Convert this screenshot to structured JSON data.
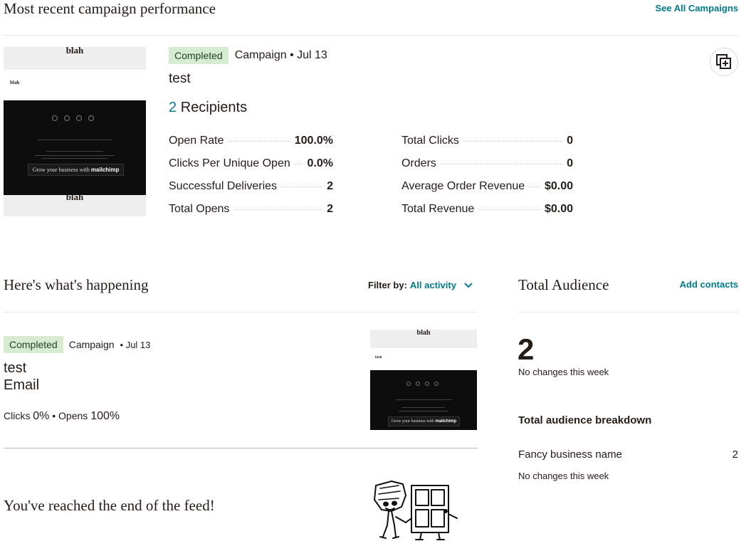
{
  "recent": {
    "heading": "Most recent campaign performance",
    "see_all": "See All Campaigns",
    "badge": "Completed",
    "meta": "Campaign • Jul 13",
    "name": "test",
    "recipients_count": "2",
    "recipients_label": "Recipients",
    "left_stats": [
      {
        "label": "Open Rate",
        "value": "100.0%"
      },
      {
        "label": "Clicks Per Unique Open",
        "value": "0.0%"
      },
      {
        "label": "Successful Deliveries",
        "value": "2"
      },
      {
        "label": "Total Opens",
        "value": "2"
      }
    ],
    "right_stats": [
      {
        "label": "Total Clicks",
        "value": "0"
      },
      {
        "label": "Orders",
        "value": "0"
      },
      {
        "label": "Average Order Revenue",
        "value": "$0.00"
      },
      {
        "label": "Total Revenue",
        "value": "$0.00"
      }
    ],
    "thumb": {
      "top": "blah",
      "small": "blah",
      "bottom": "blah",
      "cta": "Grow your business with",
      "logo": "mailchimp"
    }
  },
  "feed": {
    "heading": "Here's what's happening",
    "filter_label": "Filter by:",
    "filter_value": "All activity",
    "item": {
      "badge": "Completed",
      "type": "Campaign",
      "date": "• Jul 13",
      "name": "test",
      "kind": "Email",
      "clicks_label": "Clicks",
      "clicks_value": "0%",
      "opens_label": "• Opens",
      "opens_value": "100%",
      "thumb": {
        "top": "blah",
        "small": "blah",
        "cta": "Grow your business with",
        "logo": "mailchimp"
      }
    },
    "end_text": "You've reached the end of the feed!"
  },
  "audience": {
    "heading": "Total Audience",
    "add_contacts": "Add contacts",
    "count": "2",
    "count_note": "No changes this week",
    "breakdown_heading": "Total audience breakdown",
    "breakdown": [
      {
        "name": "Fancy business name",
        "count": "2",
        "note": "No changes this week"
      }
    ]
  },
  "colors": {
    "accent": "#007c89",
    "badge_bg": "#d7ead2",
    "text": "#241c15"
  }
}
